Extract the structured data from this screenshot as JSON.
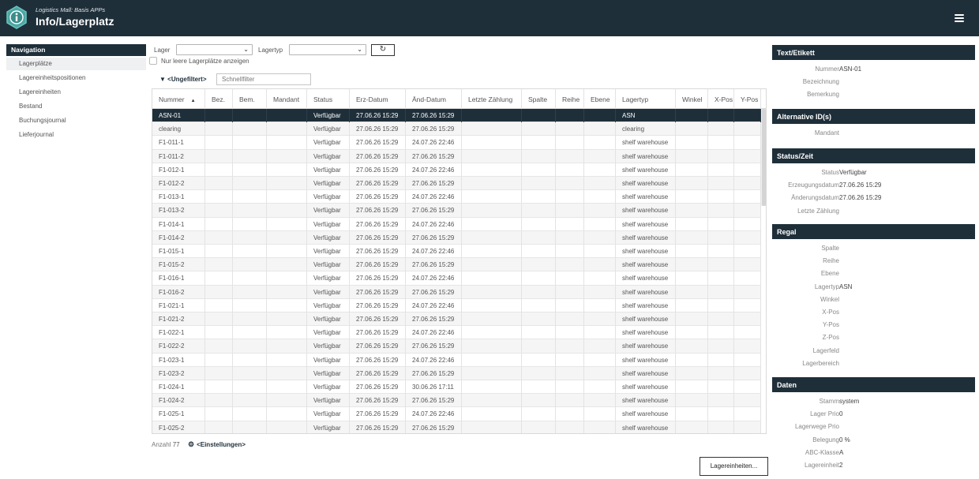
{
  "app": {
    "subtitle": "Logistics Mall: Basis APPs",
    "title": "Info/Lagerplatz",
    "accent": "#1f2f3a"
  },
  "nav": {
    "header": "Navigation",
    "items": [
      {
        "label": "Lagerplätze",
        "active": true
      },
      {
        "label": "Lagereinheitspositionen"
      },
      {
        "label": "Lagereinheiten"
      },
      {
        "label": "Bestand"
      },
      {
        "label": "Buchungsjournal"
      },
      {
        "label": "Lieferjournal"
      }
    ]
  },
  "filters": {
    "lager_label": "Lager",
    "lager_value": "",
    "lagertyp_label": "Lagertyp",
    "lagertyp_value": "",
    "refresh_icon": "refresh-icon",
    "empty_checkbox_label": "Nur leere Lagerplätze anzeigen",
    "empty_checked": false,
    "filter_toggle": "<Ungefiltert>",
    "quickfilter_placeholder": "Schnellfilter"
  },
  "table": {
    "columns": [
      "Nummer",
      "Bez.",
      "Bem.",
      "Mandant",
      "Status",
      "Erz-Datum",
      "Änd-Datum",
      "Letzte Zählung",
      "Spalte",
      "Reihe",
      "Ebene",
      "Lagertyp",
      "Winkel",
      "X-Pos",
      "Y-Pos"
    ],
    "sorted_by": "Nummer",
    "rows": [
      {
        "nummer": "ASN-01",
        "status": "Verfügbar",
        "erz": "27.06.26 15:29",
        "aend": "27.06.26 15:29",
        "lagertyp": "ASN",
        "selected": true
      },
      {
        "nummer": "clearing",
        "status": "Verfügbar",
        "erz": "27.06.26 15:29",
        "aend": "27.06.26 15:29",
        "lagertyp": "clearing"
      },
      {
        "nummer": "F1-011-1",
        "status": "Verfügbar",
        "erz": "27.06.26 15:29",
        "aend": "24.07.26 22:46",
        "lagertyp": "shelf warehouse"
      },
      {
        "nummer": "F1-011-2",
        "status": "Verfügbar",
        "erz": "27.06.26 15:29",
        "aend": "27.06.26 15:29",
        "lagertyp": "shelf warehouse"
      },
      {
        "nummer": "F1-012-1",
        "status": "Verfügbar",
        "erz": "27.06.26 15:29",
        "aend": "24.07.26 22:46",
        "lagertyp": "shelf warehouse"
      },
      {
        "nummer": "F1-012-2",
        "status": "Verfügbar",
        "erz": "27.06.26 15:29",
        "aend": "27.06.26 15:29",
        "lagertyp": "shelf warehouse"
      },
      {
        "nummer": "F1-013-1",
        "status": "Verfügbar",
        "erz": "27.06.26 15:29",
        "aend": "24.07.26 22:46",
        "lagertyp": "shelf warehouse"
      },
      {
        "nummer": "F1-013-2",
        "status": "Verfügbar",
        "erz": "27.06.26 15:29",
        "aend": "27.06.26 15:29",
        "lagertyp": "shelf warehouse"
      },
      {
        "nummer": "F1-014-1",
        "status": "Verfügbar",
        "erz": "27.06.26 15:29",
        "aend": "24.07.26 22:46",
        "lagertyp": "shelf warehouse"
      },
      {
        "nummer": "F1-014-2",
        "status": "Verfügbar",
        "erz": "27.06.26 15:29",
        "aend": "27.06.26 15:29",
        "lagertyp": "shelf warehouse"
      },
      {
        "nummer": "F1-015-1",
        "status": "Verfügbar",
        "erz": "27.06.26 15:29",
        "aend": "24.07.26 22:46",
        "lagertyp": "shelf warehouse"
      },
      {
        "nummer": "F1-015-2",
        "status": "Verfügbar",
        "erz": "27.06.26 15:29",
        "aend": "27.06.26 15:29",
        "lagertyp": "shelf warehouse"
      },
      {
        "nummer": "F1-016-1",
        "status": "Verfügbar",
        "erz": "27.06.26 15:29",
        "aend": "24.07.26 22:46",
        "lagertyp": "shelf warehouse"
      },
      {
        "nummer": "F1-016-2",
        "status": "Verfügbar",
        "erz": "27.06.26 15:29",
        "aend": "27.06.26 15:29",
        "lagertyp": "shelf warehouse"
      },
      {
        "nummer": "F1-021-1",
        "status": "Verfügbar",
        "erz": "27.06.26 15:29",
        "aend": "24.07.26 22:46",
        "lagertyp": "shelf warehouse"
      },
      {
        "nummer": "F1-021-2",
        "status": "Verfügbar",
        "erz": "27.06.26 15:29",
        "aend": "27.06.26 15:29",
        "lagertyp": "shelf warehouse"
      },
      {
        "nummer": "F1-022-1",
        "status": "Verfügbar",
        "erz": "27.06.26 15:29",
        "aend": "24.07.26 22:46",
        "lagertyp": "shelf warehouse"
      },
      {
        "nummer": "F1-022-2",
        "status": "Verfügbar",
        "erz": "27.06.26 15:29",
        "aend": "27.06.26 15:29",
        "lagertyp": "shelf warehouse"
      },
      {
        "nummer": "F1-023-1",
        "status": "Verfügbar",
        "erz": "27.06.26 15:29",
        "aend": "24.07.26 22:46",
        "lagertyp": "shelf warehouse"
      },
      {
        "nummer": "F1-023-2",
        "status": "Verfügbar",
        "erz": "27.06.26 15:29",
        "aend": "27.06.26 15:29",
        "lagertyp": "shelf warehouse"
      },
      {
        "nummer": "F1-024-1",
        "status": "Verfügbar",
        "erz": "27.06.26 15:29",
        "aend": "30.06.26 17:11",
        "lagertyp": "shelf warehouse"
      },
      {
        "nummer": "F1-024-2",
        "status": "Verfügbar",
        "erz": "27.06.26 15:29",
        "aend": "27.06.26 15:29",
        "lagertyp": "shelf warehouse"
      },
      {
        "nummer": "F1-025-1",
        "status": "Verfügbar",
        "erz": "27.06.26 15:29",
        "aend": "24.07.26 22:46",
        "lagertyp": "shelf warehouse"
      },
      {
        "nummer": "F1-025-2",
        "status": "Verfügbar",
        "erz": "27.06.26 15:29",
        "aend": "27.06.26 15:29",
        "lagertyp": "shelf warehouse"
      }
    ]
  },
  "footer": {
    "count_label": "Anzahl",
    "count_value": "77",
    "settings_label": "<Einstellungen>",
    "action_button": "Lagereinheiten..."
  },
  "details": {
    "sections": [
      {
        "title": "Text/Etikett",
        "props": [
          {
            "key": "Nummer",
            "value": "ASN-01"
          },
          {
            "key": "Bezeichnung",
            "value": ""
          },
          {
            "key": "Bemerkung",
            "value": ""
          }
        ]
      },
      {
        "title": "Alternative ID(s)",
        "props": [
          {
            "key": "Mandant",
            "value": ""
          }
        ]
      },
      {
        "title": "Status/Zeit",
        "props": [
          {
            "key": "Status",
            "value": "Verfügbar"
          },
          {
            "key": "Erzeugungsdatum",
            "value": "27.06.26 15:29"
          },
          {
            "key": "Änderungsdatum",
            "value": "27.06.26 15:29"
          },
          {
            "key": "Letzte Zählung",
            "value": ""
          }
        ]
      },
      {
        "title": "Regal",
        "props": [
          {
            "key": "Spalte",
            "value": ""
          },
          {
            "key": "Reihe",
            "value": ""
          },
          {
            "key": "Ebene",
            "value": ""
          },
          {
            "key": "Lagertyp",
            "value": "ASN"
          },
          {
            "key": "Winkel",
            "value": ""
          },
          {
            "key": "X-Pos",
            "value": ""
          },
          {
            "key": "Y-Pos",
            "value": ""
          },
          {
            "key": "Z-Pos",
            "value": ""
          },
          {
            "key": "Lagerfeld",
            "value": ""
          },
          {
            "key": "Lagerbereich",
            "value": ""
          }
        ]
      },
      {
        "title": "Daten",
        "props": [
          {
            "key": "Stamm",
            "value": "system"
          },
          {
            "key": "Lager Prio",
            "value": "0"
          },
          {
            "key": "Lagerwege Prio",
            "value": ""
          },
          {
            "key": "Belegung",
            "value": "0 %"
          },
          {
            "key": "ABC-Klasse",
            "value": "A"
          },
          {
            "key": "Lagereinheit",
            "value": "2"
          }
        ]
      }
    ]
  }
}
